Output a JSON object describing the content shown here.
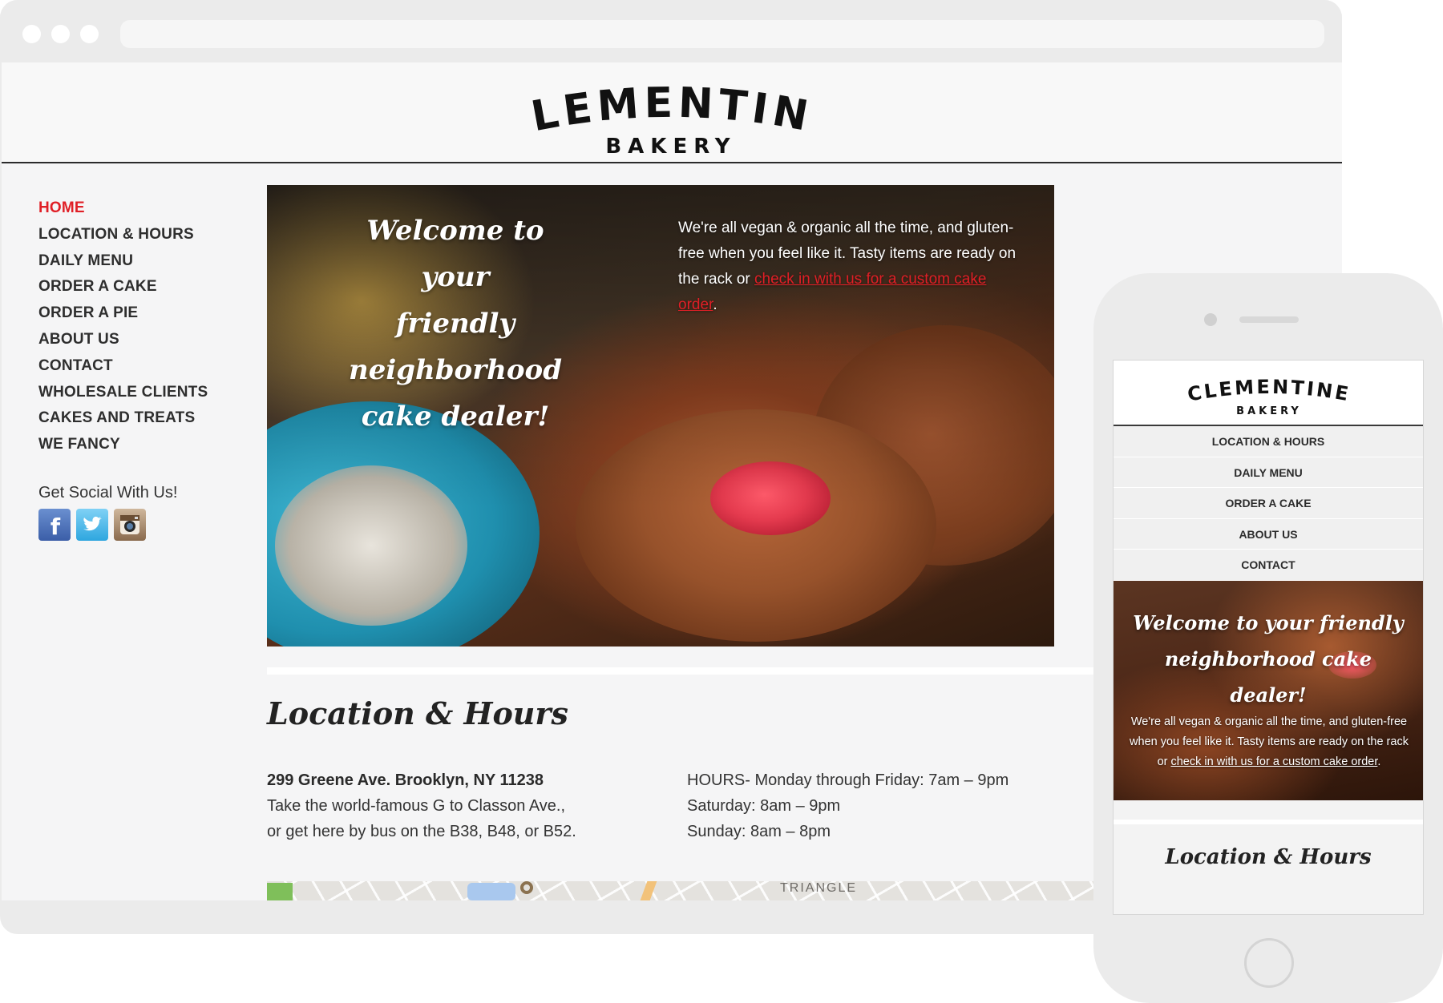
{
  "brand": {
    "name": "CLEMENTINE",
    "subtitle": "BAKERY"
  },
  "desktop": {
    "nav": [
      {
        "label": "HOME",
        "active": true
      },
      {
        "label": "LOCATION & HOURS",
        "active": false
      },
      {
        "label": "DAILY MENU",
        "active": false
      },
      {
        "label": "ORDER A CAKE",
        "active": false
      },
      {
        "label": "ORDER A PIE",
        "active": false
      },
      {
        "label": "ABOUT US",
        "active": false
      },
      {
        "label": "CONTACT",
        "active": false
      },
      {
        "label": "WHOLESALE CLIENTS",
        "active": false
      },
      {
        "label": "CAKES AND TREATS",
        "active": false
      },
      {
        "label": "WE FANCY",
        "active": false
      }
    ],
    "social": {
      "title": "Get Social With Us!",
      "icons": [
        "facebook-icon",
        "twitter-icon",
        "instagram-icon"
      ]
    },
    "hero": {
      "heading_line1": "Welcome to your",
      "heading_line2": "friendly neighborhood",
      "heading_line3": "cake dealer!",
      "text_before_link": "We're all vegan & organic all the time, and gluten-free when you feel like it. Tasty items are ready on the rack or ",
      "link_text": "check in with us for a custom cake order",
      "text_after_link": "."
    },
    "location": {
      "title": "Location & Hours",
      "address_line1": "299 Greene Ave. Brooklyn, NY 11238",
      "address_line2": "Take the world-famous G to Classon Ave.,",
      "address_line3": "or get here by bus on the B38, B48, or B52.",
      "hours_line1": "HOURS- Monday through Friday: 7am – 9pm",
      "hours_line2": "Saturday: 8am – 9pm",
      "hours_line3": "Sunday: 8am – 8pm"
    },
    "map": {
      "label": "TRIANGLE"
    }
  },
  "mobile": {
    "nav": [
      {
        "label": "LOCATION & HOURS"
      },
      {
        "label": "DAILY MENU"
      },
      {
        "label": "ORDER A CAKE"
      },
      {
        "label": "ABOUT US"
      },
      {
        "label": "CONTACT"
      }
    ],
    "hero": {
      "heading_line1": "Welcome to your friendly",
      "heading_line2": "neighborhood cake dealer!",
      "text_before_link": "We're all vegan & organic all the time, and gluten-free when you feel like it. Tasty items are ready on the rack or ",
      "link_text": "check in with us for a custom cake order",
      "text_after_link": "."
    },
    "section_title": "Location & Hours"
  },
  "colors": {
    "accent": "#e01f26",
    "nav_text": "#2e2e2e",
    "page_bg": "#f5f5f6",
    "frame": "#ebebeb"
  }
}
